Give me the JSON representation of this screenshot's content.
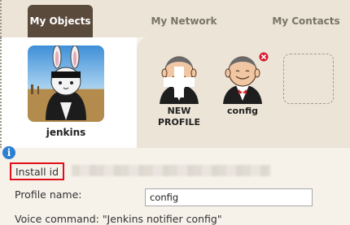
{
  "tabs": [
    {
      "label": "My Objects",
      "active": true
    },
    {
      "label": "My Network",
      "active": false
    },
    {
      "label": "My Contacts",
      "active": false
    }
  ],
  "user": {
    "name": "jenkins"
  },
  "objects": [
    {
      "label_line1": "NEW",
      "label_line2": "PROFILE",
      "icon": "jenkins-butler-plus-icon"
    },
    {
      "label_line1": "config",
      "icon": "jenkins-butler-icon"
    }
  ],
  "form": {
    "install_id_label": "Install id",
    "profile_name_label": "Profile name:",
    "profile_name_value": "config",
    "voice_command": "Voice command: \"Jenkins notifier config\""
  },
  "colors": {
    "active_tab": "#5a4a3c",
    "highlight_border": "#e0101a",
    "info_icon": "#2c7fd2",
    "panel": "#ebe4d7"
  }
}
